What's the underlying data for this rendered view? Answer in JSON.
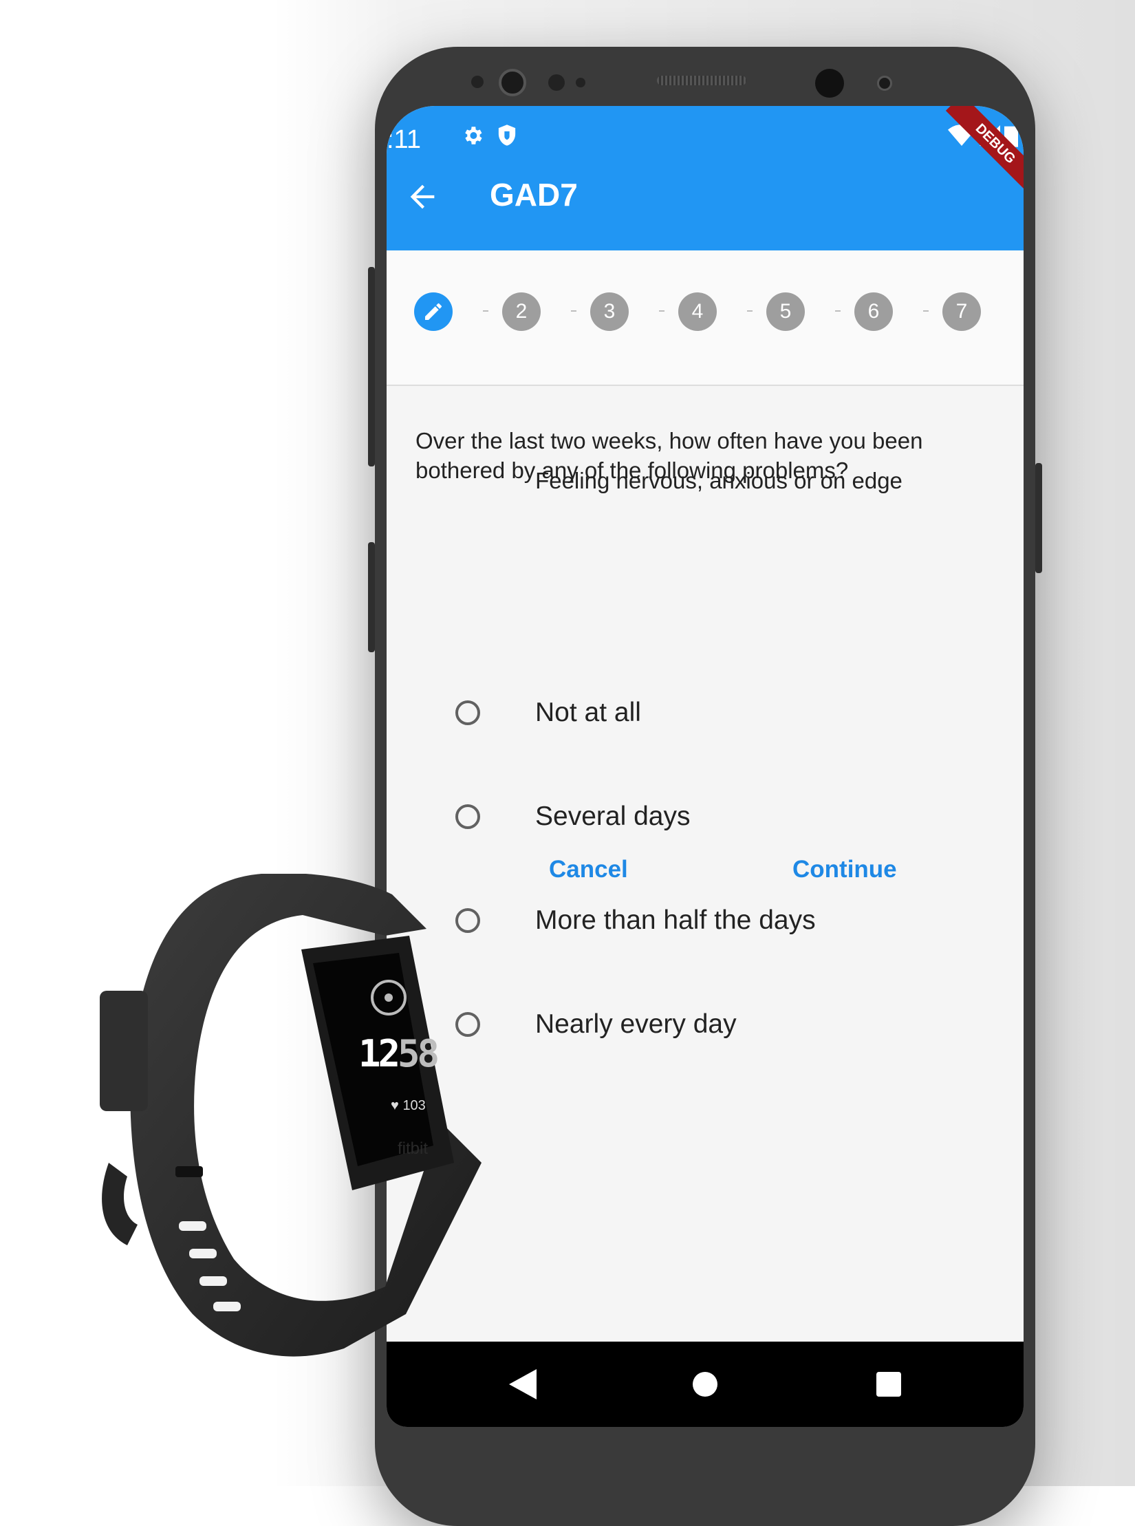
{
  "status_bar": {
    "time": ":11"
  },
  "app_bar": {
    "title": "GAD7",
    "debug_banner": "DEBUG"
  },
  "stepper": {
    "active_icon": "pencil-icon",
    "steps": [
      "2",
      "3",
      "4",
      "5",
      "6",
      "7"
    ]
  },
  "question": {
    "prompt": "Over the last two weeks, how often have you been bothered by any of the following problems?",
    "item": "Feeling nervous, anxious or on edge"
  },
  "options": [
    "Not at all",
    "Several days",
    "More than half the days",
    "Nearly every day"
  ],
  "actions": {
    "cancel": "Cancel",
    "continue": "Continue"
  },
  "tracker": {
    "steps": "1258",
    "steps_dim": "58",
    "steps_bright": "12",
    "heart_rate": "103",
    "brand": "fitbit"
  },
  "colors": {
    "accent": "#2196f3",
    "link": "#1e88e5",
    "step_inactive": "#9e9e9e"
  }
}
